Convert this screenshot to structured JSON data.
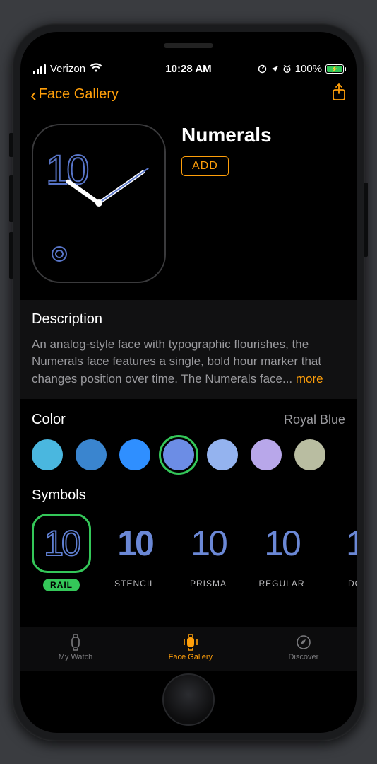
{
  "status": {
    "carrier": "Verizon",
    "time": "10:28 AM",
    "battery_percent": "100%"
  },
  "nav": {
    "back_label": "Face Gallery"
  },
  "face": {
    "name": "Numerals",
    "add_label": "ADD"
  },
  "description": {
    "heading": "Description",
    "text": "An analog-style face with typographic flourishes, the Numerals face features a single, bold hour marker that changes position over time. The Numerals face... ",
    "more": "more"
  },
  "color": {
    "heading": "Color",
    "selected_name": "Royal Blue",
    "swatches": [
      "#4ab7df",
      "#3a85cf",
      "#2f8fff",
      "#6c8de5",
      "#94b3ef",
      "#b8a7ea",
      "#b9bda1"
    ],
    "selected_index": 3
  },
  "symbols": {
    "heading": "Symbols",
    "items": [
      {
        "label": "RAIL",
        "selected": true
      },
      {
        "label": "STENCIL",
        "selected": false
      },
      {
        "label": "PRISMA",
        "selected": false
      },
      {
        "label": "REGULAR",
        "selected": false
      },
      {
        "label": "DO",
        "selected": false
      }
    ]
  },
  "tabs": {
    "my_watch": "My Watch",
    "face_gallery": "Face Gallery",
    "discover": "Discover"
  }
}
